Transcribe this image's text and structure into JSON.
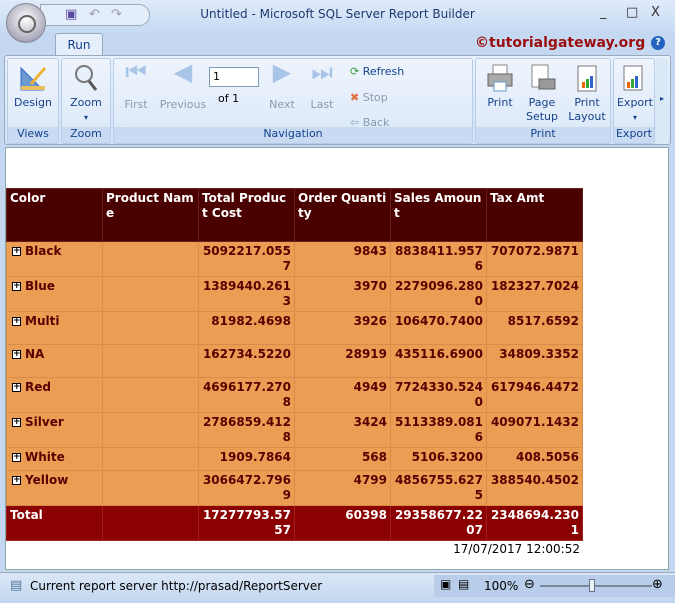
{
  "window": {
    "title": "Untitled - Microsoft SQL Server Report Builder",
    "minimize": "_",
    "maximize": "□",
    "close": "X"
  },
  "tabs": [
    {
      "label": "Run"
    }
  ],
  "brand": "©tutorialgateway.org",
  "help": "?",
  "ribbon": {
    "views": {
      "label": "Views",
      "design": "Design"
    },
    "zoom": {
      "label": "Zoom",
      "zoom": "Zoom"
    },
    "navigation": {
      "label": "Navigation",
      "first": "First",
      "previous": "Previous",
      "page_value": "1",
      "of": "of",
      "total_pages": "1",
      "next": "Next",
      "last": "Last",
      "refresh": "Refresh",
      "stop": "Stop",
      "back": "Back"
    },
    "print": {
      "label": "Print",
      "print": "Print",
      "page_setup": "Page Setup",
      "print_layout": "Print Layout"
    },
    "export": {
      "label": "Export",
      "export": "Export"
    }
  },
  "report": {
    "headers": [
      "Color",
      "Product Name",
      "Total Product Cost",
      "Order Quantity",
      "Sales Amount",
      "Tax Amt"
    ],
    "rows": [
      [
        "Black",
        "",
        "5092217.0557",
        "9843",
        "8838411.9576",
        "707072.9871"
      ],
      [
        "Blue",
        "",
        "1389440.2613",
        "3970",
        "2279096.2800",
        "182327.7024"
      ],
      [
        "Multi",
        "",
        "81982.4698",
        "3926",
        "106470.7400",
        "8517.6592"
      ],
      [
        "NA",
        "",
        "162734.5220",
        "28919",
        "435116.6900",
        "34809.3352"
      ],
      [
        "Red",
        "",
        "4696177.2708",
        "4949",
        "7724330.5240",
        "617946.4472"
      ],
      [
        "Silver",
        "",
        "2786859.4128",
        "3424",
        "5113389.0816",
        "409071.1432"
      ],
      [
        "White",
        "",
        "1909.7864",
        "568",
        "5106.3200",
        "408.5056"
      ],
      [
        "Yellow",
        "",
        "3066472.7969",
        "4799",
        "4856755.6275",
        "388540.4502"
      ]
    ],
    "total": [
      "Total",
      "",
      "17277793.5757",
      "60398",
      "29358677.2207",
      "2348694.2301"
    ],
    "timestamp": "17/07/2017 12:00:52"
  },
  "status": {
    "text": "Current report server http://prasad/ReportServer",
    "zoom": "100%"
  }
}
